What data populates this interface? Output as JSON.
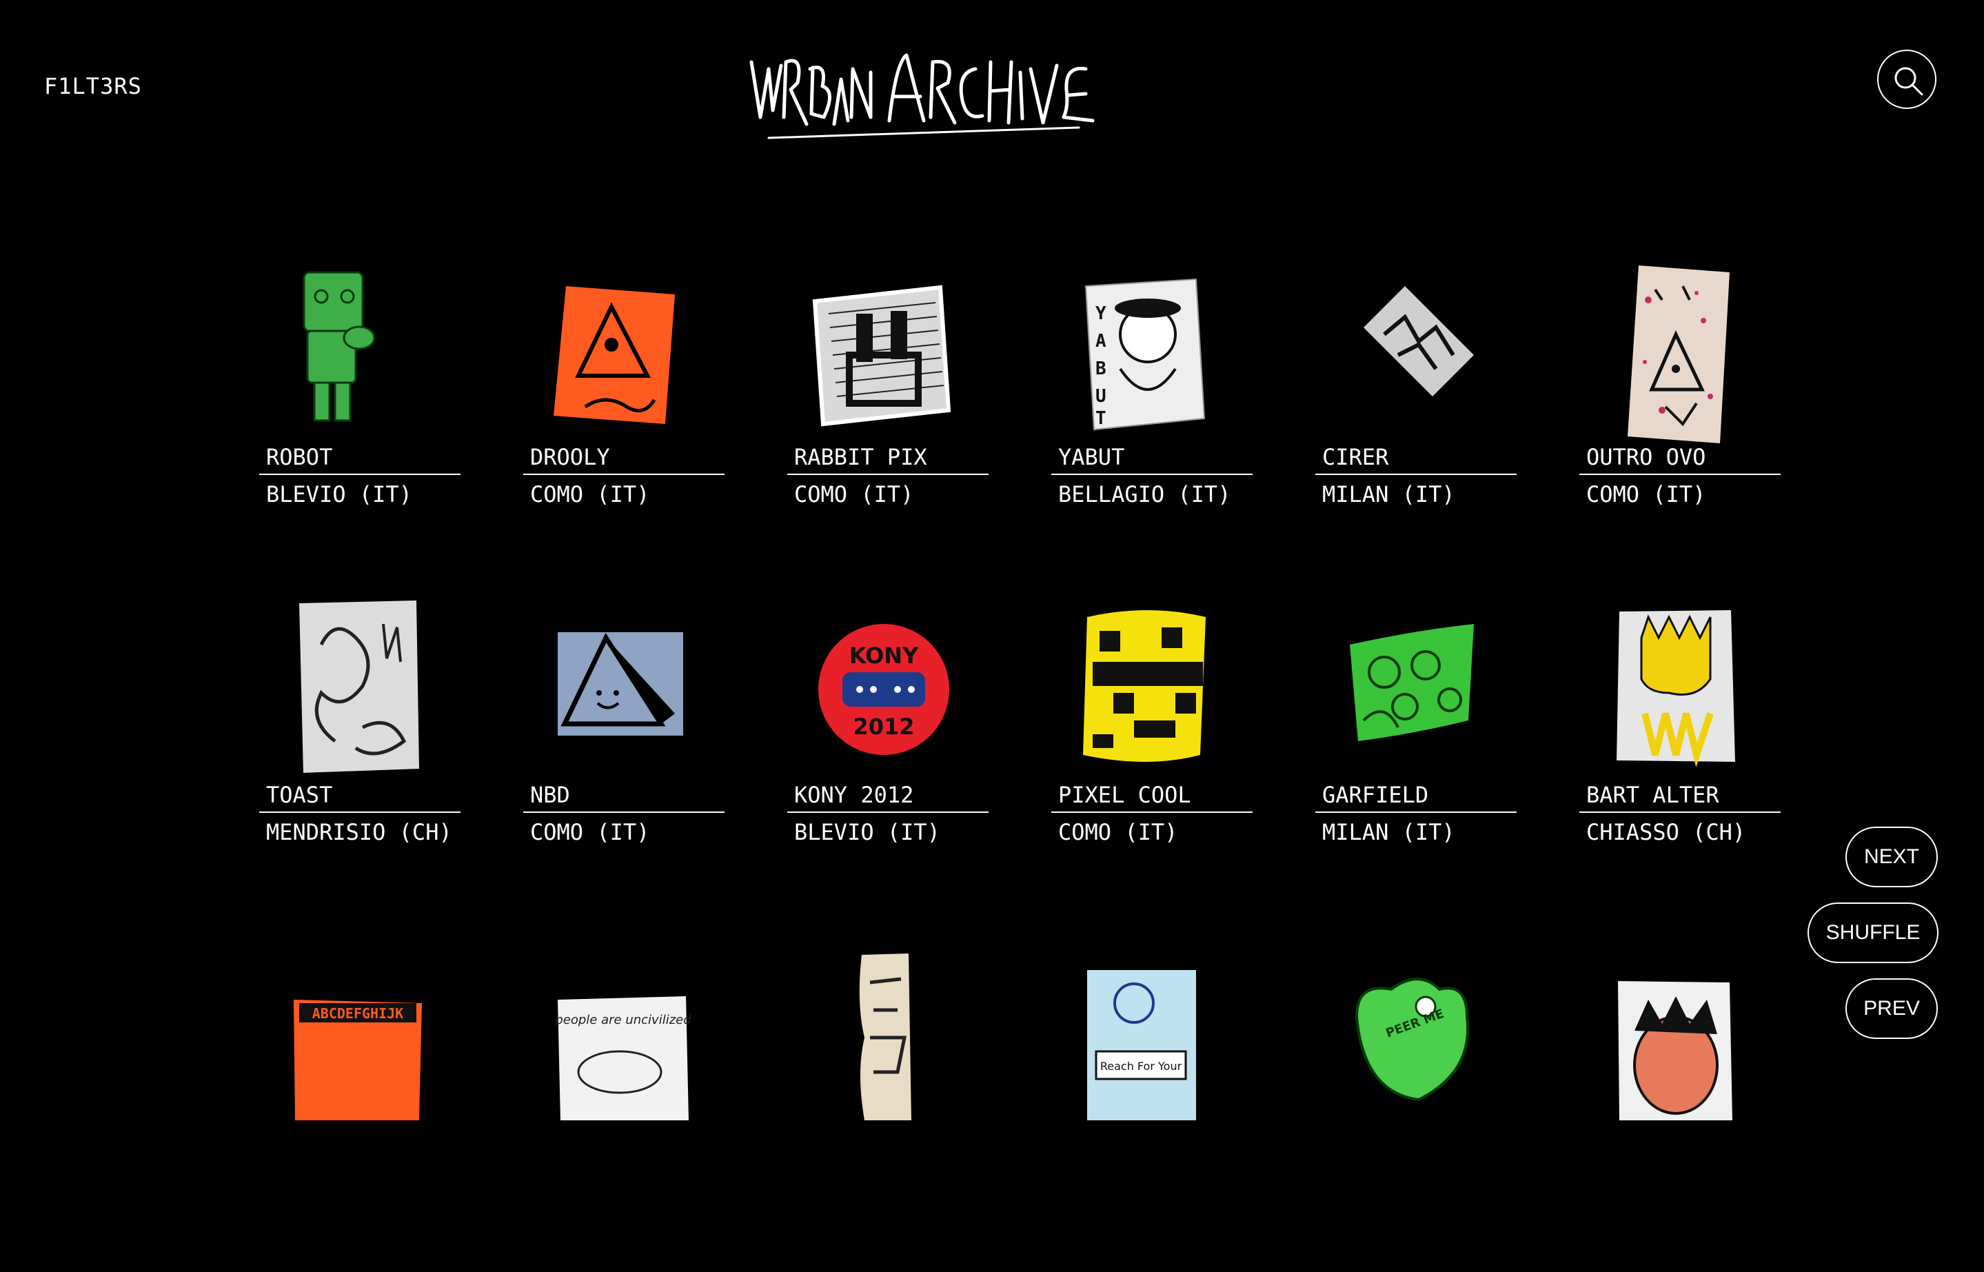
{
  "header": {
    "filters_label": "F1LT3RS",
    "logo_text": "URBAN ARCHIVE"
  },
  "nav": {
    "next": "NEXT",
    "shuffle": "SHUFFLE",
    "prev": "PREV"
  },
  "rows": [
    [
      {
        "name": "ROBOT",
        "location": "BLEVIO (IT)",
        "color": "#3fae49"
      },
      {
        "name": "DROOLY",
        "location": "COMO (IT)",
        "color": "#ff5a1f"
      },
      {
        "name": "RABBIT PIX",
        "location": "COMO (IT)",
        "color": "#d9d9d9"
      },
      {
        "name": "YABUT",
        "location": "BELLAGIO (IT)",
        "color": "#eeeeee"
      },
      {
        "name": "CIRER",
        "location": "MILAN (IT)",
        "color": "#cfcfcf"
      },
      {
        "name": "OUTRO OVO",
        "location": "COMO (IT)",
        "color": "#e8d8cc"
      }
    ],
    [
      {
        "name": "TOAST",
        "location": "MENDRISIO (CH)",
        "color": "#dcdcdc"
      },
      {
        "name": "NBD",
        "location": "COMO (IT)",
        "color": "#8fa3c2"
      },
      {
        "name": "KONY 2012",
        "location": "BLEVIO (IT)",
        "color": "#e8202a"
      },
      {
        "name": "PIXEL COOL",
        "location": "COMO (IT)",
        "color": "#f5e20c"
      },
      {
        "name": "GARFIELD",
        "location": "MILAN (IT)",
        "color": "#39c43a"
      },
      {
        "name": "BART ALTER",
        "location": "CHIASSO (CH)",
        "color": "#e6e6e6"
      }
    ],
    [
      {
        "color": "#ff5a1f",
        "label": "ABCDEFGHIJK"
      },
      {
        "color": "#f2f2f2",
        "label": "people are uncivilized"
      },
      {
        "color": "#e9dcc5"
      },
      {
        "color": "#bfe1f0",
        "label": "Reach For Your"
      },
      {
        "color": "#4ccf4c",
        "label": "PEER ME"
      },
      {
        "color": "#f0f0f0"
      }
    ]
  ]
}
